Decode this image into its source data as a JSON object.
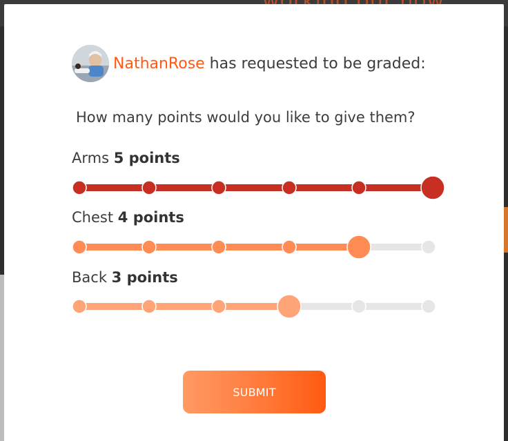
{
  "backdrop": {
    "headline": "working out now"
  },
  "modal": {
    "user_name": "NathanRose",
    "request_text": " has requested to be graded:",
    "question": "How many points would you like to give them?",
    "criteria": [
      {
        "name": "Arms",
        "points_label": "5 points",
        "value": 5,
        "max": 5,
        "fill_color": "#c62f22",
        "dot_color": "#c62f22"
      },
      {
        "name": "Chest",
        "points_label": "4 points",
        "value": 4,
        "max": 5,
        "fill_color": "#ff8c55",
        "dot_color": "#ff8c55"
      },
      {
        "name": "Back",
        "points_label": "3 points",
        "value": 3,
        "max": 5,
        "fill_color": "#ffa477",
        "dot_color": "#ffa477"
      }
    ],
    "inactive_color": "#e6e6e6",
    "submit_label": "SUBMIT"
  }
}
